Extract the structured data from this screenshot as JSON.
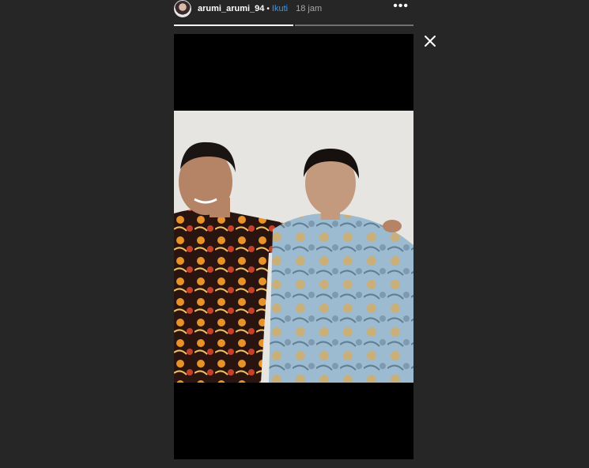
{
  "header": {
    "username": "arumi_arumi_94",
    "separator": "•",
    "follow_label": "Ikuti",
    "time": "18 jam",
    "more_icon": "more-horizontal-icon"
  },
  "progress": {
    "segments": 2,
    "active_index": 0
  },
  "close_icon": "close-icon",
  "colors": {
    "background": "#262626",
    "follow": "#3897f0",
    "frame": "#000000"
  }
}
